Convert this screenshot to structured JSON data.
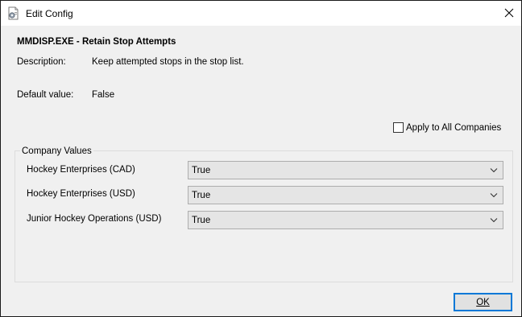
{
  "window": {
    "title": "Edit Config",
    "icon": "config-document-icon",
    "close_icon": "close-icon"
  },
  "config": {
    "heading": "MMDISP.EXE - Retain Stop Attempts",
    "description_label": "Description:",
    "description_value": "Keep attempted stops in the stop list.",
    "default_label": "Default value:",
    "default_value": "False"
  },
  "apply_all": {
    "label": "Apply to All Companies",
    "checked": false
  },
  "company_values": {
    "title": "Company Values",
    "rows": [
      {
        "company": "Hockey Enterprises (CAD)",
        "value": "True"
      },
      {
        "company": "Hockey Enterprises (USD)",
        "value": "True"
      },
      {
        "company": "Junior Hockey Operations (USD)",
        "value": "True"
      }
    ]
  },
  "buttons": {
    "ok_label": "OK"
  },
  "colors": {
    "dialog_background": "#f0f0f0",
    "titlebar_background": "#ffffff",
    "focus_accent": "#0078d7",
    "dropdown_background": "#e5e5e5"
  }
}
